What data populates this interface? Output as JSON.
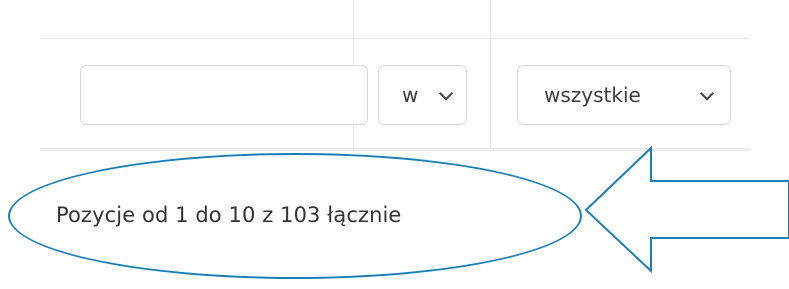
{
  "filters": {
    "text_input_value": "",
    "select_small_value": "w",
    "select_large_value": "wszystkie"
  },
  "table_info": {
    "entries_text": "Pozycje od 1 do 10 z 103 łącznie"
  },
  "annotations": {
    "color": "#1a7fb6"
  }
}
